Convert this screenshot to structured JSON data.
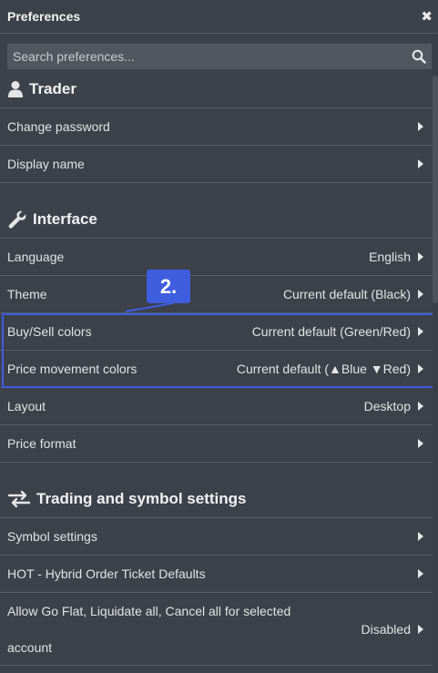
{
  "window": {
    "title": "Preferences",
    "close_icon": "close-icon"
  },
  "search": {
    "placeholder": "Search preferences...",
    "value": ""
  },
  "sections": {
    "trader": {
      "title": "Trader",
      "icon": "user-icon",
      "rows": [
        {
          "label": "Change password",
          "value": ""
        },
        {
          "label": "Display name",
          "value": ""
        }
      ]
    },
    "interface": {
      "title": "Interface",
      "icon": "wrench-icon",
      "rows": [
        {
          "label": "Language",
          "value": "English"
        },
        {
          "label": "Theme",
          "value": "Current default (Black)"
        },
        {
          "label": "Buy/Sell colors",
          "value": "Current default (Green/Red)"
        },
        {
          "label": "Price movement colors",
          "value": "Current default (▲Blue ▼Red)"
        },
        {
          "label": "Layout",
          "value": "Desktop"
        },
        {
          "label": "Price format",
          "value": ""
        }
      ]
    },
    "trading": {
      "title": "Trading and symbol settings",
      "icon": "swap-arrows-icon",
      "rows": [
        {
          "label": "Symbol settings",
          "value": ""
        },
        {
          "label": "HOT - Hybrid Order Ticket Defaults",
          "value": ""
        },
        {
          "label": "Allow Go Flat, Liquidate all, Cancel all for selected account",
          "value": "Disabled"
        }
      ]
    }
  },
  "annotation": {
    "callout_label": "2.",
    "accent_color": "#3f5ddf"
  },
  "colors": {
    "background": "#3c414a",
    "divider": "#565c65",
    "search_bg": "#52575f"
  }
}
